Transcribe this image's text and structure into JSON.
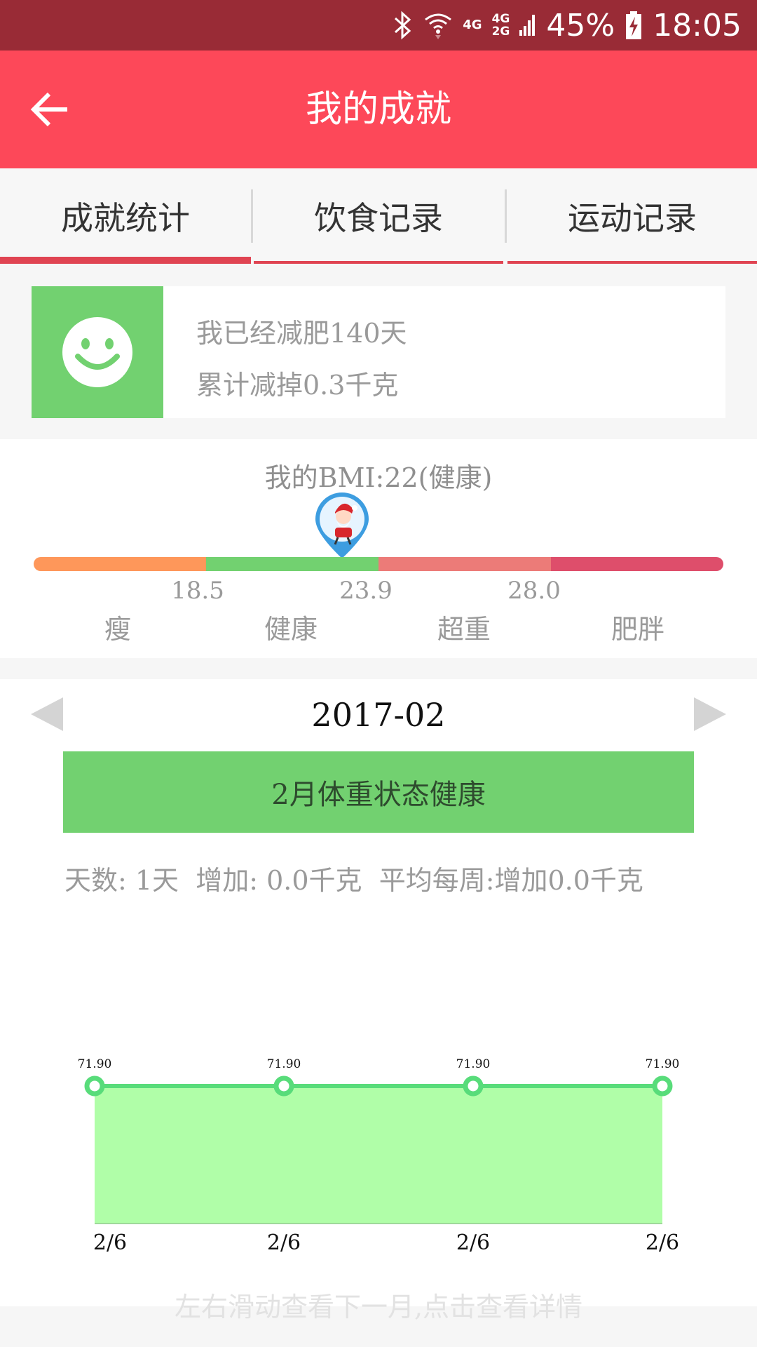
{
  "status_bar": {
    "battery": "45%",
    "time": "18:05",
    "net_4g": "4G",
    "net_4g2g_top": "4G",
    "net_4g2g_bottom": "2G",
    "icons": [
      "bluetooth-icon",
      "wifi-icon",
      "signal-icon",
      "battery-charging-icon"
    ]
  },
  "app_bar": {
    "title": "我的成就",
    "back_icon": "arrow-left-icon"
  },
  "tabs": [
    {
      "label": "成就统计",
      "active": true
    },
    {
      "label": "饮食记录",
      "active": false
    },
    {
      "label": "运动记录",
      "active": false
    }
  ],
  "achievement": {
    "icon": "smiley-icon",
    "days_text": "我已经减肥140天",
    "loss_text": "累计减掉0.3千克"
  },
  "bmi": {
    "title": "我的BMI:22(健康)",
    "value": 22,
    "ticks": [
      "18.5",
      "23.9",
      "28.0"
    ],
    "categories": [
      "瘦",
      "健康",
      "超重",
      "肥胖"
    ],
    "colors": [
      "#fe975a",
      "#72d170",
      "#ec7b78",
      "#de4e6b"
    ],
    "marker_icon": "santa-marker-icon"
  },
  "month": {
    "label": "2017-02",
    "banner": "2月体重状态健康",
    "stats": "天数: 1天  增加: 0.0千克  平均每周:增加0.0千克",
    "hint": "左右滑动查看下一月,点击查看详情"
  },
  "chart_data": {
    "type": "area",
    "categories": [
      "2/6",
      "2/6",
      "2/6",
      "2/6"
    ],
    "series": [
      {
        "values": [
          71.9,
          71.9,
          71.9,
          71.9
        ]
      }
    ],
    "data_labels": [
      "71.90",
      "71.90",
      "71.90",
      "71.90"
    ],
    "line_color": "#58dc7a",
    "fill_color": "#b0fea8",
    "title": "",
    "xlabel": "",
    "ylabel": ""
  }
}
